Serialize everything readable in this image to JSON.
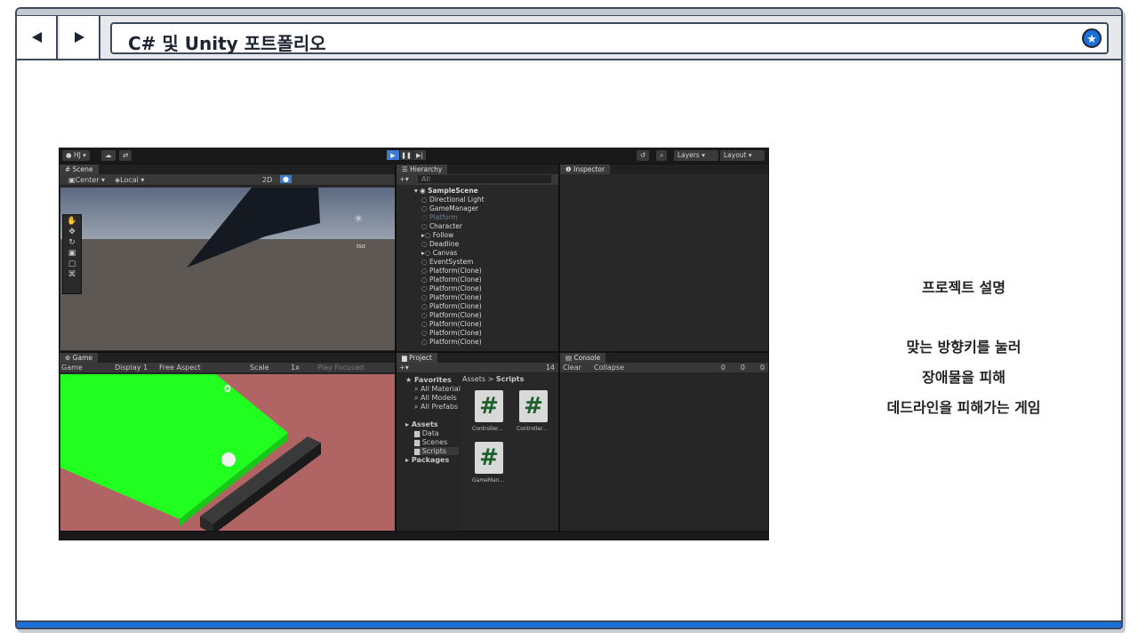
{
  "browser": {
    "title": "C# 및 Unity 포트폴리오",
    "back_icon": "triangle-left-icon",
    "forward_icon": "triangle-right-icon",
    "bookmark_icon": "star-icon",
    "accent": "#1b6fd8"
  },
  "unity": {
    "account": "HJ",
    "layers": "Layers",
    "layout": "Layout",
    "scene_tab": "Scene",
    "pivot": "Center",
    "space": "Local",
    "mode_2d": "2D",
    "iso": "Iso",
    "hierarchy_tab": "Hierarchy",
    "search_all": "All",
    "hierarchy": [
      {
        "name": "SampleScene",
        "kind": "scene"
      },
      {
        "name": "Directional Light"
      },
      {
        "name": "GameManager"
      },
      {
        "name": "Platform",
        "dim": true
      },
      {
        "name": "Character"
      },
      {
        "name": "Follow",
        "arrow": true
      },
      {
        "name": "Deadline"
      },
      {
        "name": "Canvas",
        "arrow": true
      },
      {
        "name": "EventSystem"
      },
      {
        "name": "Platform(Clone)"
      },
      {
        "name": "Platform(Clone)"
      },
      {
        "name": "Platform(Clone)"
      },
      {
        "name": "Platform(Clone)"
      },
      {
        "name": "Platform(Clone)"
      },
      {
        "name": "Platform(Clone)"
      },
      {
        "name": "Platform(Clone)"
      },
      {
        "name": "Platform(Clone)"
      },
      {
        "name": "Platform(Clone)"
      }
    ],
    "inspector_tab": "Inspector",
    "game_tab": "Game",
    "game_mode": "Game",
    "display": "Display 1",
    "aspect": "Free Aspect",
    "scale_label": "Scale",
    "scale_value": "1x",
    "play_focused": "Play Focused",
    "score": "0",
    "project_tab": "Project",
    "project_count": "14",
    "favorites": "Favorites",
    "fav_items": [
      "All Material",
      "All Models",
      "All Prefabs"
    ],
    "assets": "Assets",
    "asset_folders": [
      "Data",
      "Scenes",
      "Scripts"
    ],
    "packages": "Packages",
    "breadcrumb_root": "Assets",
    "breadcrumb_leaf": "Scripts",
    "files": [
      "Controller...",
      "Controller...",
      "GameMan..."
    ],
    "console_tab": "Console",
    "clear": "Clear",
    "collapse": "Collapse",
    "log_count": "0",
    "warn_count": "0",
    "err_count": "0"
  },
  "description": {
    "heading": "프로젝트 설명",
    "lines": [
      "맞는 방향키를 눌러",
      "장애물을 피해",
      "데드라인을 피해가는 게임"
    ]
  }
}
